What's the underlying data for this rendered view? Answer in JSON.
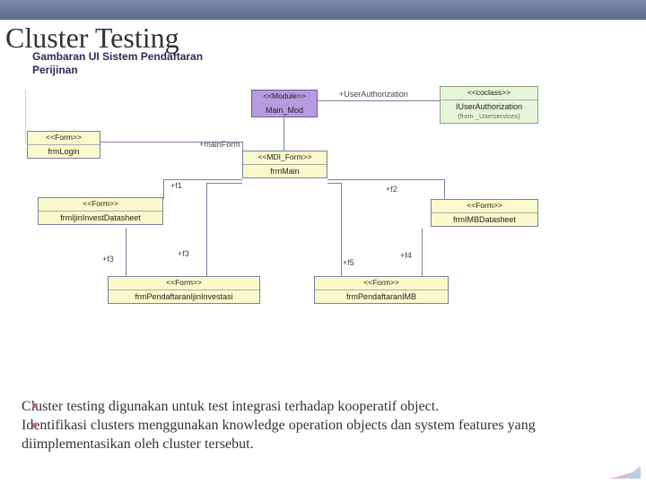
{
  "title": "Cluster Testing",
  "subtitle_l1": "Gambaran UI Sistem Pendaftaran",
  "subtitle_l2": "Perijinan",
  "boxes": {
    "module": {
      "stereo": "<<Module>>",
      "name": "Main_Mod"
    },
    "coclass": {
      "stereo": "<<coclass>>",
      "name": "IUserAuthorization",
      "from": "(from _Userservices)"
    },
    "login": {
      "stereo": "<<Form>>",
      "name": "frmLogin"
    },
    "main": {
      "stereo": "<<MDI_Form>>",
      "name": "frmMain"
    },
    "ijinds": {
      "stereo": "<<Form>>",
      "name": "frmIjinInvestDatasheet"
    },
    "imbds": {
      "stereo": "<<Form>>",
      "name": "frmIMBDatasheet"
    },
    "pendijin": {
      "stereo": "<<Form>>",
      "name": "frmPendaftaranIjinInvestasi"
    },
    "pendimb": {
      "stereo": "<<Form>>",
      "name": "frmPendaftaranIMB"
    }
  },
  "labels": {
    "userauth": "+UserAuthorization",
    "mainform": "+mainForm",
    "f1": "+f1",
    "f2": "+f2",
    "f3a": "+f3",
    "f3b": "+f3",
    "f4": "+f4",
    "f5": "+f5"
  },
  "body": {
    "p1": "Cluster testing digunakan untuk test integrasi terhadap kooperatif object.",
    "p2": "Identifikasi clusters menggunakan knowledge operation objects dan system features yang diimplementasikan oleh cluster tersebut."
  }
}
